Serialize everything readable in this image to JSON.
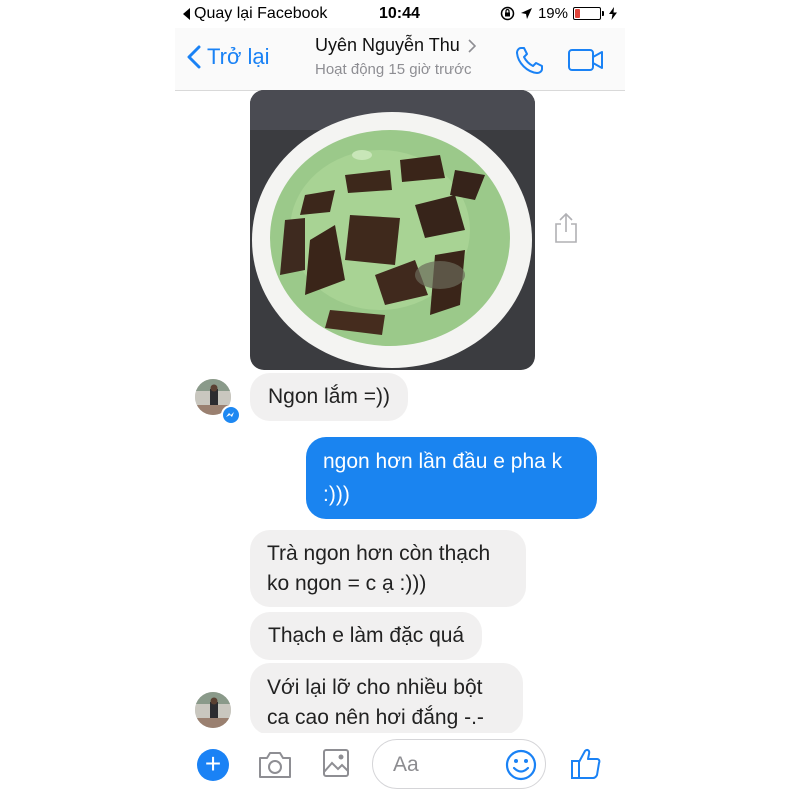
{
  "status_bar": {
    "back_app": "Quay lại Facebook",
    "time": "10:44",
    "battery": "19%",
    "battery_level": 0.19,
    "icons": [
      "signal-icon",
      "rotation-lock-icon",
      "location-icon",
      "battery-icon",
      "charging-icon"
    ]
  },
  "header": {
    "back_label": "Trở lại",
    "contact_name": "Uyên Nguyễn Thu",
    "active_status": "Hoạt động 15 giờ trước",
    "icons": [
      "chevron-left-icon",
      "chevron-right-icon",
      "phone-icon",
      "video-camera-icon"
    ]
  },
  "messages": [
    {
      "from": "contact",
      "type": "image",
      "description_icon": "share-icon"
    },
    {
      "from": "contact",
      "text": "Ngon lắm =))"
    },
    {
      "from": "me",
      "text_lines": [
        "ngon hơn lần đầu e pha k",
        ":)))"
      ]
    },
    {
      "from": "contact",
      "text_lines": [
        "Trà ngon hơn còn thạch",
        "ko ngon = c ạ :)))"
      ]
    },
    {
      "from": "contact",
      "text": "Thạch e làm đặc quá"
    },
    {
      "from": "contact",
      "text_lines": [
        "Với lại lỡ cho nhiều bột",
        "ca cao nên hơi đắng -.-"
      ]
    }
  ],
  "composer": {
    "placeholder": "Aa",
    "icons": [
      "plus-icon",
      "camera-icon",
      "gallery-icon",
      "emoji-icon",
      "thumbs-up-icon"
    ]
  },
  "colors": {
    "accent": "#1a82f5",
    "outgoing_bubble": "#1a84f0",
    "incoming_bubble": "#f1f0f0",
    "battery_low": "#e0443a"
  }
}
